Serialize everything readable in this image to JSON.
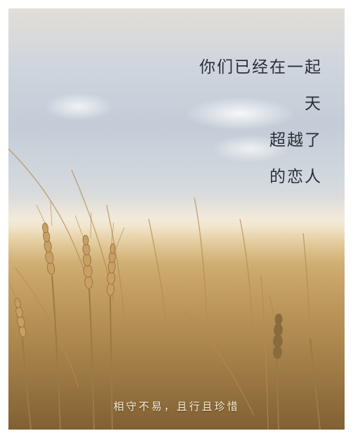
{
  "headline": {
    "line1": "你们已经在一起",
    "line2": "天",
    "line3": "超越了",
    "line4": "的恋人"
  },
  "footer": {
    "text": "相守不易，且行且珍惜"
  },
  "colors": {
    "headline_text": "#2b2f37",
    "footer_text": "#f4ecd8",
    "sky": "#c3ccd7",
    "wheat": "#bd9658"
  }
}
